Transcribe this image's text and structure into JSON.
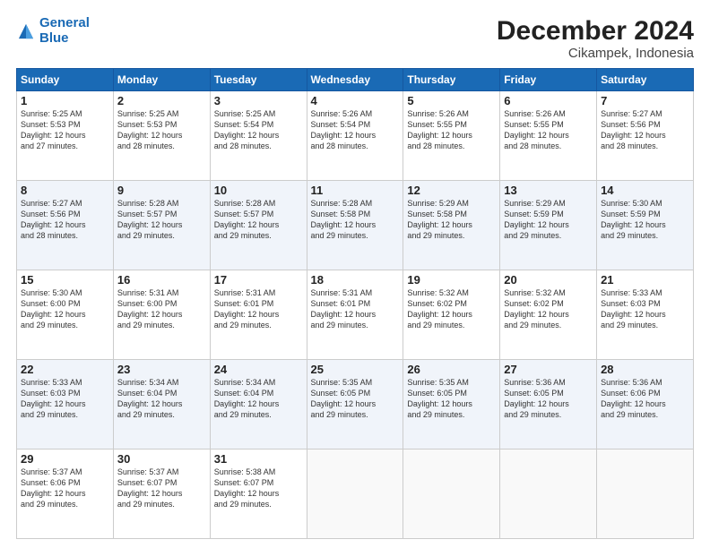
{
  "logo": {
    "line1": "General",
    "line2": "Blue"
  },
  "title": "December 2024",
  "subtitle": "Cikampek, Indonesia",
  "days_header": [
    "Sunday",
    "Monday",
    "Tuesday",
    "Wednesday",
    "Thursday",
    "Friday",
    "Saturday"
  ],
  "weeks": [
    [
      {
        "day": "1",
        "info": "Sunrise: 5:25 AM\nSunset: 5:53 PM\nDaylight: 12 hours\nand 27 minutes."
      },
      {
        "day": "2",
        "info": "Sunrise: 5:25 AM\nSunset: 5:53 PM\nDaylight: 12 hours\nand 28 minutes."
      },
      {
        "day": "3",
        "info": "Sunrise: 5:25 AM\nSunset: 5:54 PM\nDaylight: 12 hours\nand 28 minutes."
      },
      {
        "day": "4",
        "info": "Sunrise: 5:26 AM\nSunset: 5:54 PM\nDaylight: 12 hours\nand 28 minutes."
      },
      {
        "day": "5",
        "info": "Sunrise: 5:26 AM\nSunset: 5:55 PM\nDaylight: 12 hours\nand 28 minutes."
      },
      {
        "day": "6",
        "info": "Sunrise: 5:26 AM\nSunset: 5:55 PM\nDaylight: 12 hours\nand 28 minutes."
      },
      {
        "day": "7",
        "info": "Sunrise: 5:27 AM\nSunset: 5:56 PM\nDaylight: 12 hours\nand 28 minutes."
      }
    ],
    [
      {
        "day": "8",
        "info": "Sunrise: 5:27 AM\nSunset: 5:56 PM\nDaylight: 12 hours\nand 28 minutes."
      },
      {
        "day": "9",
        "info": "Sunrise: 5:28 AM\nSunset: 5:57 PM\nDaylight: 12 hours\nand 29 minutes."
      },
      {
        "day": "10",
        "info": "Sunrise: 5:28 AM\nSunset: 5:57 PM\nDaylight: 12 hours\nand 29 minutes."
      },
      {
        "day": "11",
        "info": "Sunrise: 5:28 AM\nSunset: 5:58 PM\nDaylight: 12 hours\nand 29 minutes."
      },
      {
        "day": "12",
        "info": "Sunrise: 5:29 AM\nSunset: 5:58 PM\nDaylight: 12 hours\nand 29 minutes."
      },
      {
        "day": "13",
        "info": "Sunrise: 5:29 AM\nSunset: 5:59 PM\nDaylight: 12 hours\nand 29 minutes."
      },
      {
        "day": "14",
        "info": "Sunrise: 5:30 AM\nSunset: 5:59 PM\nDaylight: 12 hours\nand 29 minutes."
      }
    ],
    [
      {
        "day": "15",
        "info": "Sunrise: 5:30 AM\nSunset: 6:00 PM\nDaylight: 12 hours\nand 29 minutes."
      },
      {
        "day": "16",
        "info": "Sunrise: 5:31 AM\nSunset: 6:00 PM\nDaylight: 12 hours\nand 29 minutes."
      },
      {
        "day": "17",
        "info": "Sunrise: 5:31 AM\nSunset: 6:01 PM\nDaylight: 12 hours\nand 29 minutes."
      },
      {
        "day": "18",
        "info": "Sunrise: 5:31 AM\nSunset: 6:01 PM\nDaylight: 12 hours\nand 29 minutes."
      },
      {
        "day": "19",
        "info": "Sunrise: 5:32 AM\nSunset: 6:02 PM\nDaylight: 12 hours\nand 29 minutes."
      },
      {
        "day": "20",
        "info": "Sunrise: 5:32 AM\nSunset: 6:02 PM\nDaylight: 12 hours\nand 29 minutes."
      },
      {
        "day": "21",
        "info": "Sunrise: 5:33 AM\nSunset: 6:03 PM\nDaylight: 12 hours\nand 29 minutes."
      }
    ],
    [
      {
        "day": "22",
        "info": "Sunrise: 5:33 AM\nSunset: 6:03 PM\nDaylight: 12 hours\nand 29 minutes."
      },
      {
        "day": "23",
        "info": "Sunrise: 5:34 AM\nSunset: 6:04 PM\nDaylight: 12 hours\nand 29 minutes."
      },
      {
        "day": "24",
        "info": "Sunrise: 5:34 AM\nSunset: 6:04 PM\nDaylight: 12 hours\nand 29 minutes."
      },
      {
        "day": "25",
        "info": "Sunrise: 5:35 AM\nSunset: 6:05 PM\nDaylight: 12 hours\nand 29 minutes."
      },
      {
        "day": "26",
        "info": "Sunrise: 5:35 AM\nSunset: 6:05 PM\nDaylight: 12 hours\nand 29 minutes."
      },
      {
        "day": "27",
        "info": "Sunrise: 5:36 AM\nSunset: 6:05 PM\nDaylight: 12 hours\nand 29 minutes."
      },
      {
        "day": "28",
        "info": "Sunrise: 5:36 AM\nSunset: 6:06 PM\nDaylight: 12 hours\nand 29 minutes."
      }
    ],
    [
      {
        "day": "29",
        "info": "Sunrise: 5:37 AM\nSunset: 6:06 PM\nDaylight: 12 hours\nand 29 minutes."
      },
      {
        "day": "30",
        "info": "Sunrise: 5:37 AM\nSunset: 6:07 PM\nDaylight: 12 hours\nand 29 minutes."
      },
      {
        "day": "31",
        "info": "Sunrise: 5:38 AM\nSunset: 6:07 PM\nDaylight: 12 hours\nand 29 minutes."
      },
      {
        "day": "",
        "info": ""
      },
      {
        "day": "",
        "info": ""
      },
      {
        "day": "",
        "info": ""
      },
      {
        "day": "",
        "info": ""
      }
    ]
  ]
}
